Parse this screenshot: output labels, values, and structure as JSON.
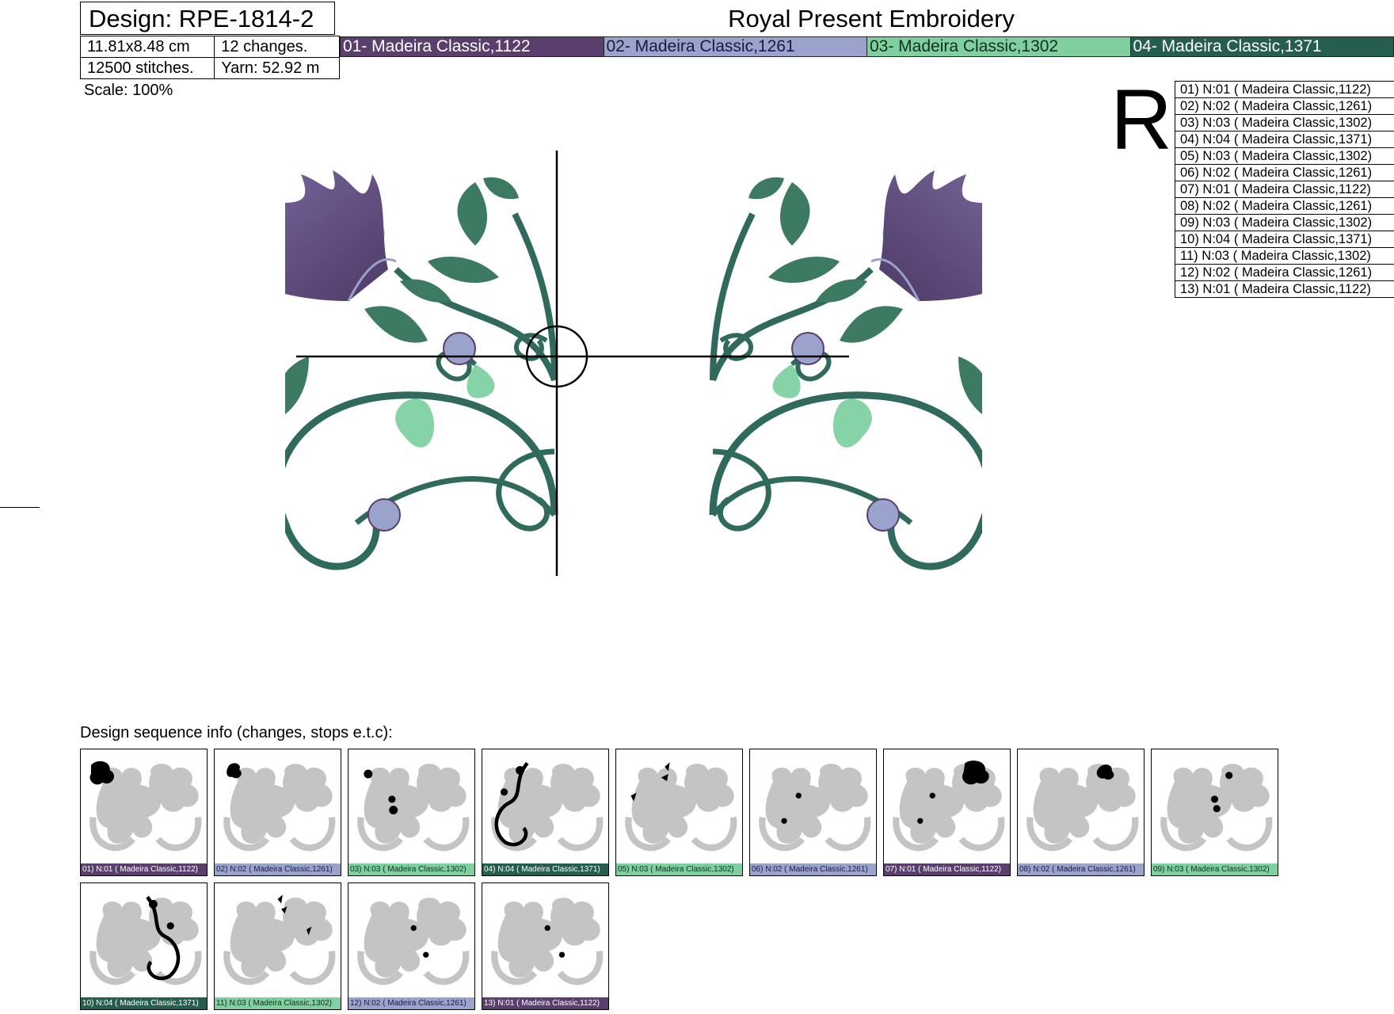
{
  "header": {
    "design_title": "Design: RPE-1814-2",
    "size": "11.81x8.48 cm",
    "changes": "12 changes.",
    "stitches": "12500 stitches.",
    "yarn": "Yarn: 52.92 m",
    "brand": "Royal Present Embroidery",
    "scale": "Scale: 100%",
    "r_mark": "R"
  },
  "colors": [
    {
      "label": "01- Madeira Classic,1122",
      "bg": "#5a3f6e",
      "fg": "#ffffff"
    },
    {
      "label": "02- Madeira Classic,1261",
      "bg": "#9aa3cc",
      "fg": "#1a1a40"
    },
    {
      "label": "03- Madeira Classic,1302",
      "bg": "#7fcfa0",
      "fg": "#10301e"
    },
    {
      "label": "04- Madeira Classic,1371",
      "bg": "#255e4e",
      "fg": "#ffffff"
    }
  ],
  "stops": [
    "01) N:01 ( Madeira Classic,1122)",
    "02) N:02 ( Madeira Classic,1261)",
    "03) N:03 ( Madeira Classic,1302)",
    "04) N:04 ( Madeira Classic,1371)",
    "05) N:03 ( Madeira Classic,1302)",
    "06) N:02 ( Madeira Classic,1261)",
    "07) N:01 ( Madeira Classic,1122)",
    "08) N:02 ( Madeira Classic,1261)",
    "09) N:03 ( Madeira Classic,1302)",
    "10) N:04 ( Madeira Classic,1371)",
    "11) N:03 ( Madeira Classic,1302)",
    "12) N:02 ( Madeira Classic,1261)",
    "13) N:01 ( Madeira Classic,1122)"
  ],
  "sequence": {
    "title": "Design sequence info (changes, stops e.t.c):",
    "thumbs": [
      {
        "caption": "01) N:01 ( Madeira Classic,1122)",
        "color": 0
      },
      {
        "caption": "02) N:02 ( Madeira Classic,1261)",
        "color": 1
      },
      {
        "caption": "03) N:03 ( Madeira Classic,1302)",
        "color": 2
      },
      {
        "caption": "04) N:04 ( Madeira Classic,1371)",
        "color": 3
      },
      {
        "caption": "05) N:03 ( Madeira Classic,1302)",
        "color": 2
      },
      {
        "caption": "06) N:02 ( Madeira Classic,1261)",
        "color": 1
      },
      {
        "caption": "07) N:01 ( Madeira Classic,1122)",
        "color": 0
      },
      {
        "caption": "08) N:02 ( Madeira Classic,1261)",
        "color": 1
      },
      {
        "caption": "09) N:03 ( Madeira Classic,1302)",
        "color": 2
      },
      {
        "caption": "10) N:04 ( Madeira Classic,1371)",
        "color": 3
      },
      {
        "caption": "11) N:03 ( Madeira Classic,1302)",
        "color": 2
      },
      {
        "caption": "12) N:02 ( Madeira Classic,1261)",
        "color": 1
      },
      {
        "caption": "13) N:01 ( Madeira Classic,1122)",
        "color": 0
      }
    ]
  }
}
